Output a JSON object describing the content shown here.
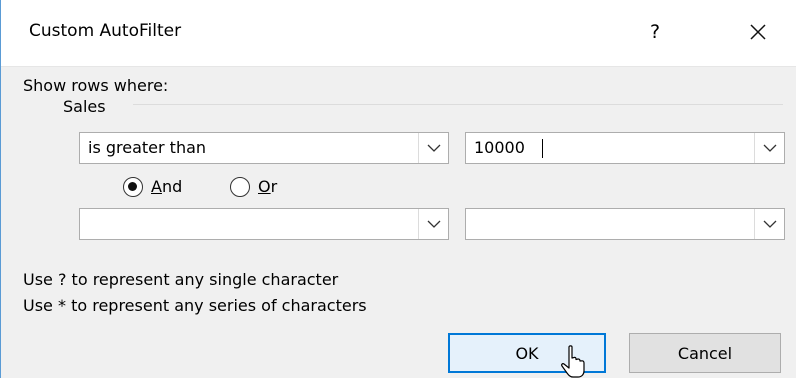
{
  "dialog": {
    "title": "Custom AutoFilter",
    "help_label": "?",
    "close_icon": "close-icon"
  },
  "criteria": {
    "heading": "Show rows where:",
    "column_name": "Sales",
    "first": {
      "operator": "is greater than",
      "value": "10000"
    },
    "logic": {
      "and_label_mnemonic": "A",
      "and_label_rest": "nd",
      "or_label_mnemonic": "O",
      "or_label_rest": "r",
      "selected": "And"
    },
    "second": {
      "operator": "",
      "value": ""
    }
  },
  "hints": {
    "single": "Use ? to represent any single character",
    "series": "Use * to represent any series of characters"
  },
  "buttons": {
    "ok": "OK",
    "cancel": "Cancel"
  },
  "icons": {
    "dropdown": "chevron-down-icon",
    "pointer": "mouse-pointer-icon"
  }
}
